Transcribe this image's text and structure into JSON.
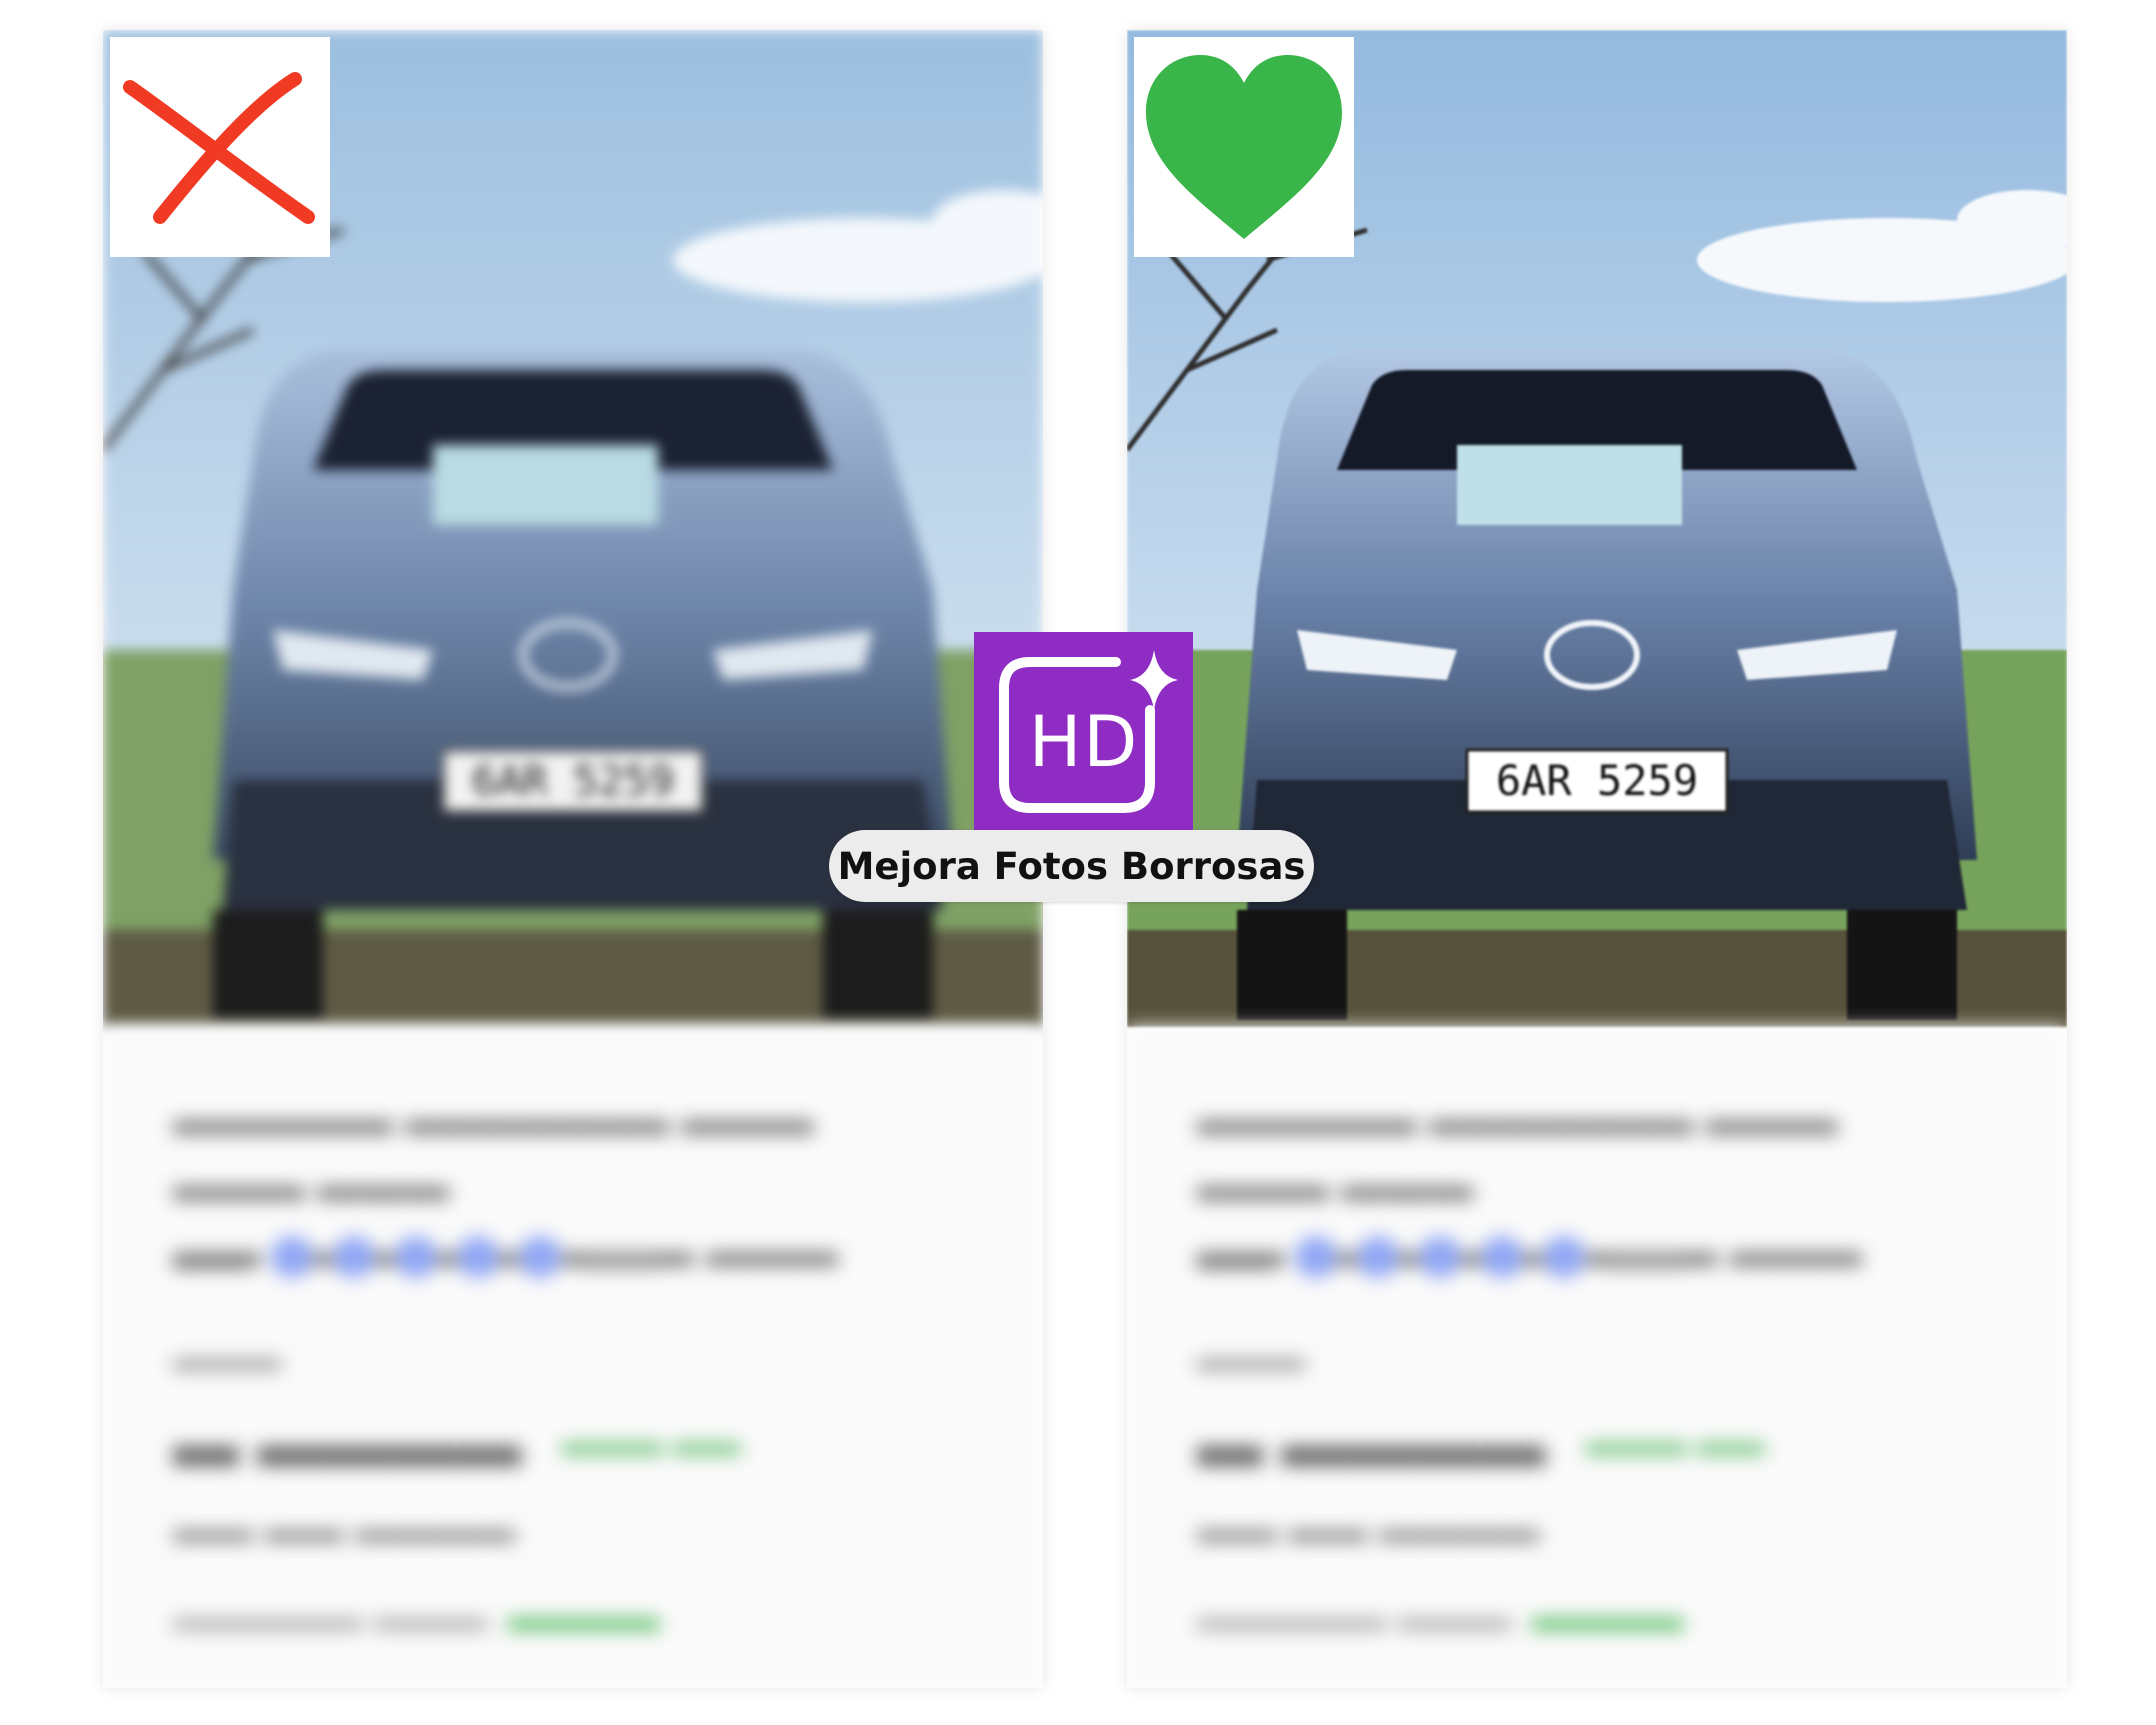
{
  "caption": "Mejora Fotos Borrosas",
  "hd_logo": {
    "text": "HD",
    "icon": "sparkle-icon",
    "color": "#8e2cc3"
  },
  "before": {
    "badge_icon": "cross-icon",
    "badge_color": "#f03a24",
    "plate": "6AR 5259"
  },
  "after": {
    "badge_icon": "heart-icon",
    "badge_color": "#39b54a",
    "plate": "6AR 5259"
  }
}
